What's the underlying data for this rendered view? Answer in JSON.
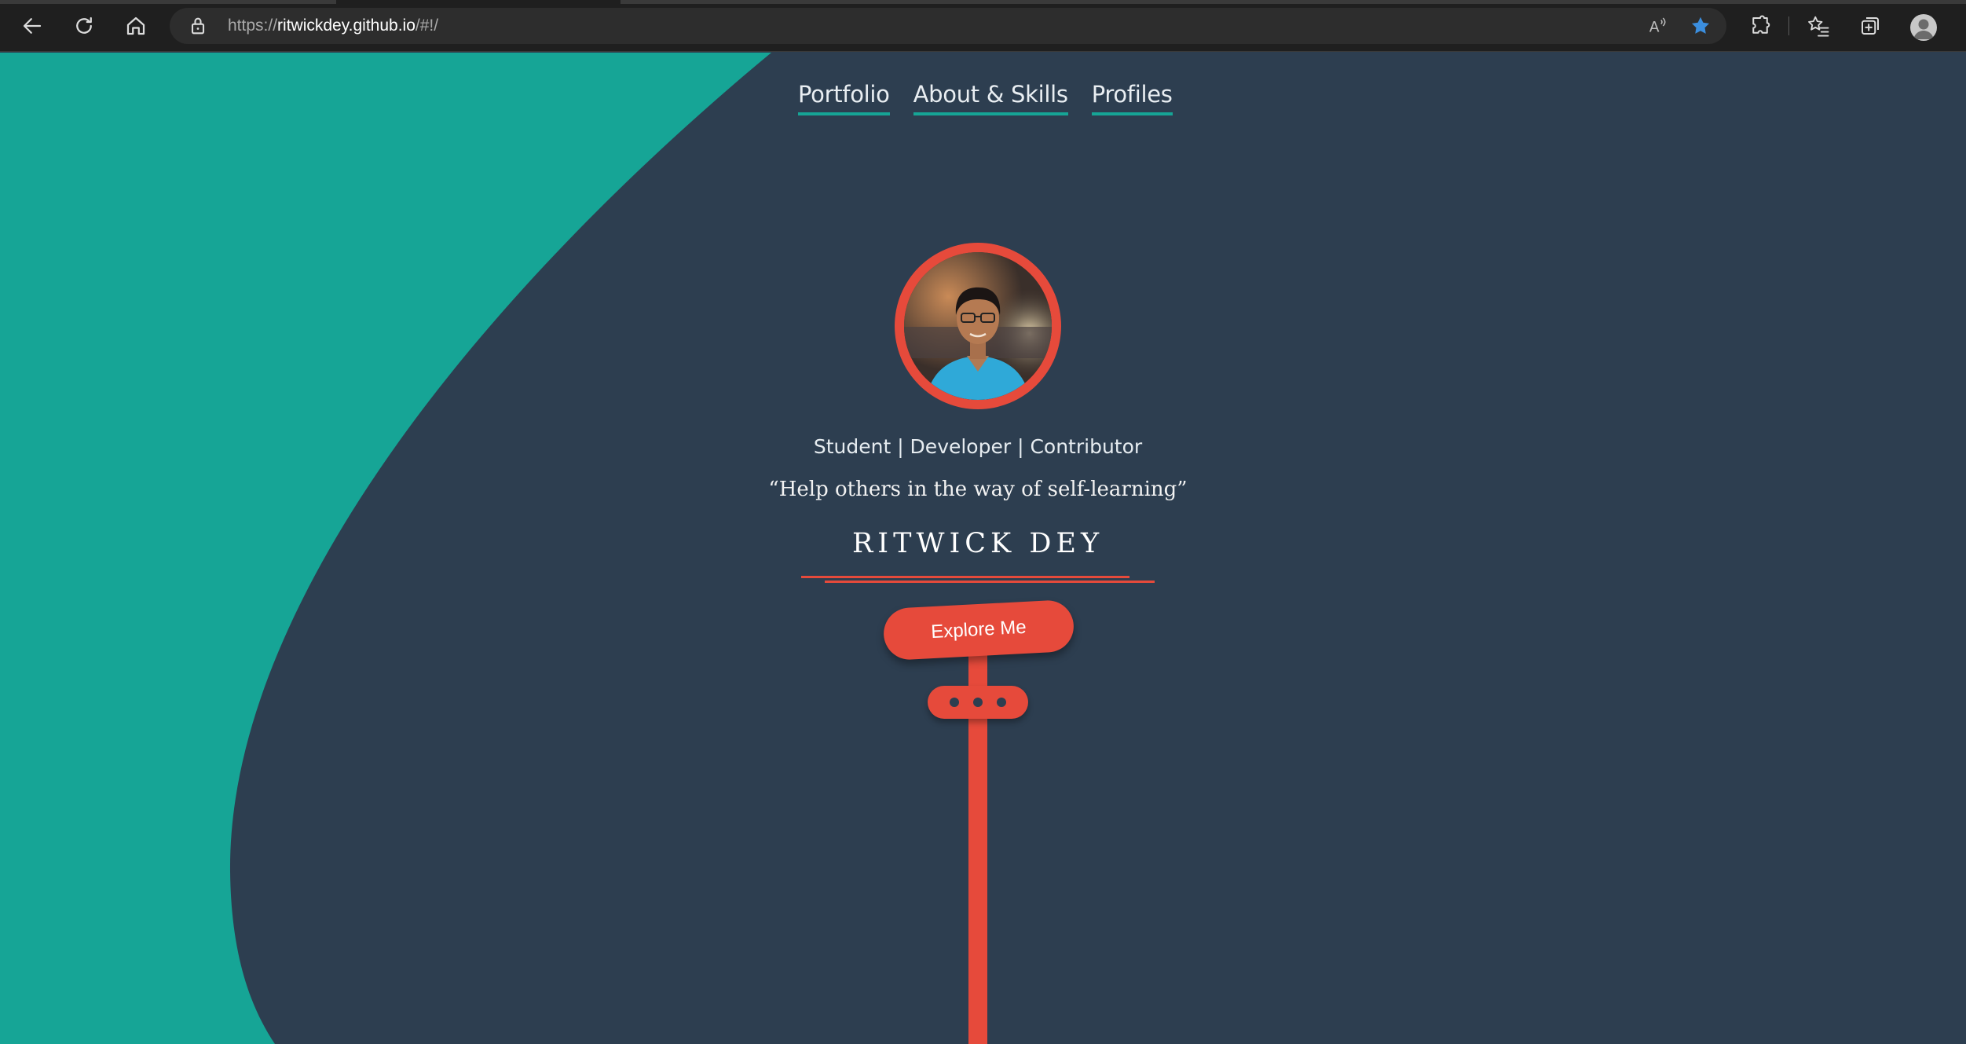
{
  "browser": {
    "url": {
      "scheme": "https://",
      "host": "ritwickdey.github.io",
      "path": "/#!/"
    },
    "icons": {
      "back": "back-arrow-icon",
      "refresh": "refresh-icon",
      "home": "home-icon",
      "lock": "lock-icon",
      "read_aloud": "read-aloud-icon",
      "favorite": "star-icon",
      "extensions": "puzzle-icon",
      "favorites": "favorites-list-icon",
      "collections": "collections-icon",
      "profile": "profile-avatar-icon"
    },
    "accent": "#3b8ede"
  },
  "nav": {
    "items": [
      {
        "label": "Portfolio"
      },
      {
        "label": "About & Skills"
      },
      {
        "label": "Profiles"
      }
    ]
  },
  "hero": {
    "tagline": "Student | Developer | Contributor",
    "quote": "“Help others in the way of self-learning”",
    "name": "RITWICK DEY",
    "explore_label": "Explore Me"
  },
  "colors": {
    "background": "#2d3e50",
    "teal": "#16a596",
    "accent_red": "#e64a3b"
  }
}
